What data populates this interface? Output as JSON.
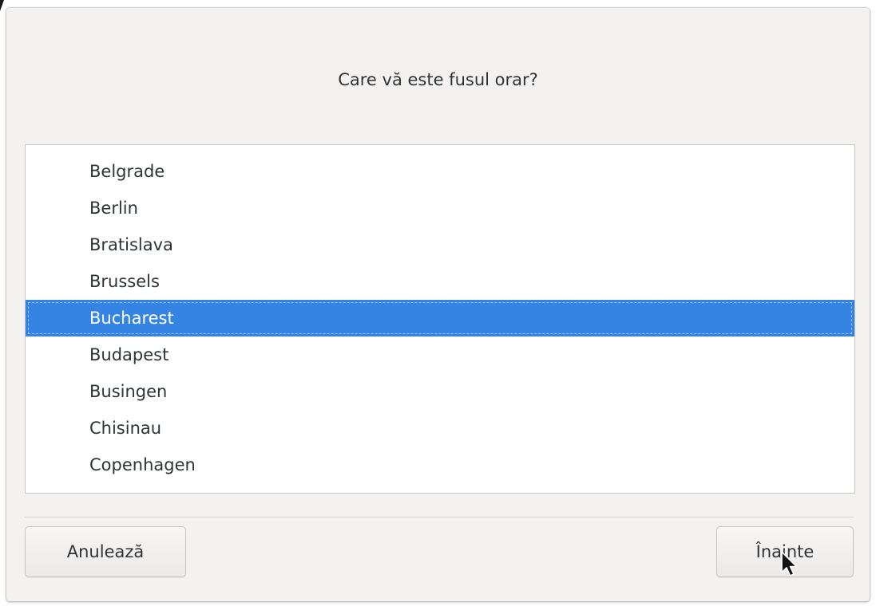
{
  "dialog": {
    "title": "Care vă este fusul orar?"
  },
  "timezones": {
    "items": [
      "Belgrade",
      "Berlin",
      "Bratislava",
      "Brussels",
      "Bucharest",
      "Budapest",
      "Busingen",
      "Chisinau",
      "Copenhagen"
    ],
    "selected": "Bucharest"
  },
  "buttons": {
    "cancel_label": "Anulează",
    "next_label": "Înainte"
  },
  "colors": {
    "selection": "#3584e4",
    "dialog_background": "#f4f2f1",
    "text": "#2e3436"
  },
  "icons": {
    "cursor": "mouse-pointer-icon"
  }
}
